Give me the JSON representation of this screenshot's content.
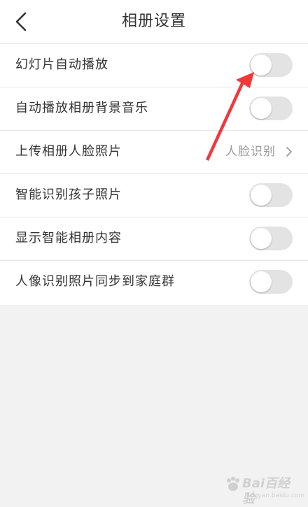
{
  "header": {
    "title": "相册设置",
    "back_icon": "chevron-left-icon"
  },
  "settings": [
    {
      "label": "幻灯片自动播放",
      "control": "toggle",
      "on": false
    },
    {
      "label": "自动播放相册背景音乐",
      "control": "toggle",
      "on": false
    },
    {
      "label": "上传相册人脸照片",
      "control": "link",
      "value": "人脸识别",
      "icon": "chevron-right-icon"
    },
    {
      "label": "智能识别孩子照片",
      "control": "toggle",
      "on": false
    },
    {
      "label": "显示智能相册内容",
      "control": "toggle",
      "on": false
    },
    {
      "label": "人像识别照片同步到家庭群",
      "control": "toggle",
      "on": false
    }
  ],
  "annotation": {
    "color": "#f0383b",
    "icon": "red-arrow-annotation"
  },
  "watermark": {
    "logo_text": "Bai百经验",
    "sub_text": "jingyan.baidu.com"
  },
  "colors": {
    "background": "#f2f2f2",
    "toggle_off": "#e3e3e3",
    "secondary_text": "#9a9a9a"
  }
}
